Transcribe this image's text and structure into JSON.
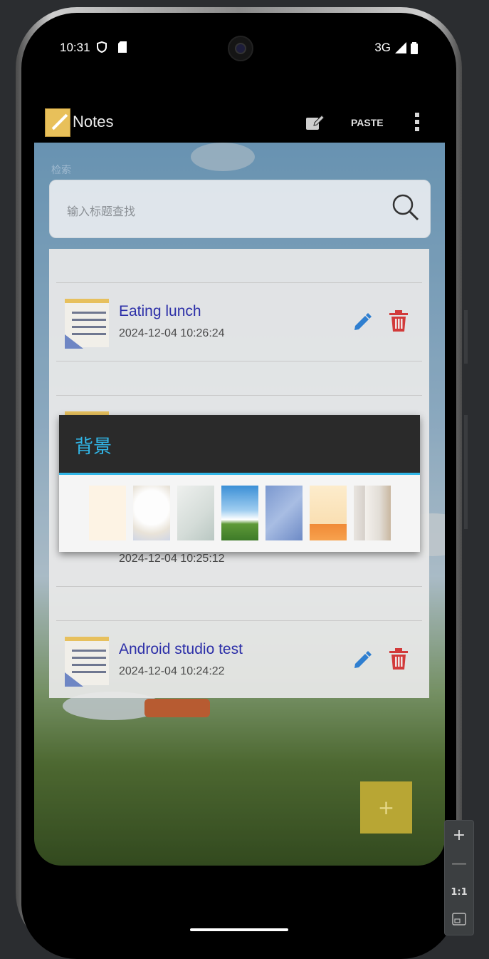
{
  "status_bar": {
    "time": "10:31",
    "network": "3G"
  },
  "app_bar": {
    "title": "Notes",
    "paste_label": "PASTE"
  },
  "search": {
    "label": "检索",
    "placeholder": "输入标题查找"
  },
  "notes": [
    {
      "title": "Eating lunch",
      "date": "2024-12-04 10:26:24"
    },
    {
      "title": "",
      "date": "2024-12-04 10:25:12"
    },
    {
      "title": "Android studio test",
      "date": "2024-12-04 10:24:22"
    }
  ],
  "dialog": {
    "title": "背景",
    "swatches": [
      "cream",
      "white-splash",
      "grey-plant",
      "sky-field",
      "blue-texture",
      "yellow-orange",
      "window-shadow"
    ]
  },
  "fab": {
    "label": "+"
  },
  "emulator": {
    "zoom_in": "+",
    "zoom_out": "—",
    "zoom_reset": "1:1"
  },
  "colors": {
    "accent": "#31b6e7",
    "note_title": "#2c2fa8",
    "delete": "#d23a3a",
    "edit": "#2f7fd0"
  }
}
